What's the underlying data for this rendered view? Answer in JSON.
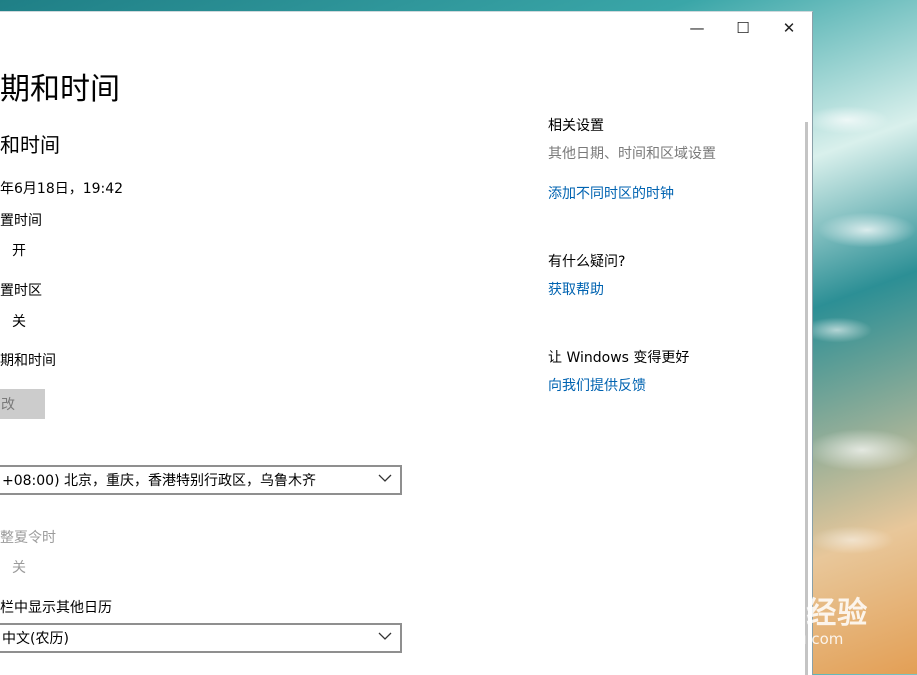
{
  "window": {
    "controls": {
      "minimize": "—",
      "maximize": "☐",
      "close": "✕"
    }
  },
  "main": {
    "page_title": "期和时间",
    "section_title": "和时间",
    "current_datetime": "年6月18日，19:42",
    "auto_time": {
      "label": "置时间",
      "state": "开"
    },
    "auto_timezone": {
      "label": "置时区",
      "state": "关"
    },
    "manual_datetime": {
      "label": "期和时间",
      "button": "改"
    },
    "timezone_select": {
      "value": "+08:00) 北京，重庆，香港特别行政区，乌鲁木齐"
    },
    "dst": {
      "label": "整夏令时",
      "state": "关"
    },
    "other_calendar": {
      "label": "栏中显示其他日历",
      "value": "中文(农历)"
    }
  },
  "related": {
    "heading": "相关设置",
    "other_settings": "其他日期、时间和区域设置",
    "add_clocks": "添加不同时区的时钟",
    "question_heading": "有什么疑问?",
    "get_help": "获取帮助",
    "improve_heading": "让 Windows 变得更好",
    "feedback": "向我们提供反馈"
  },
  "watermark": {
    "brand": "Baidu经验",
    "domain": "jingyan.baidu.com"
  },
  "colors": {
    "link": "#0063b1",
    "disabled": "#9b9b9b"
  }
}
